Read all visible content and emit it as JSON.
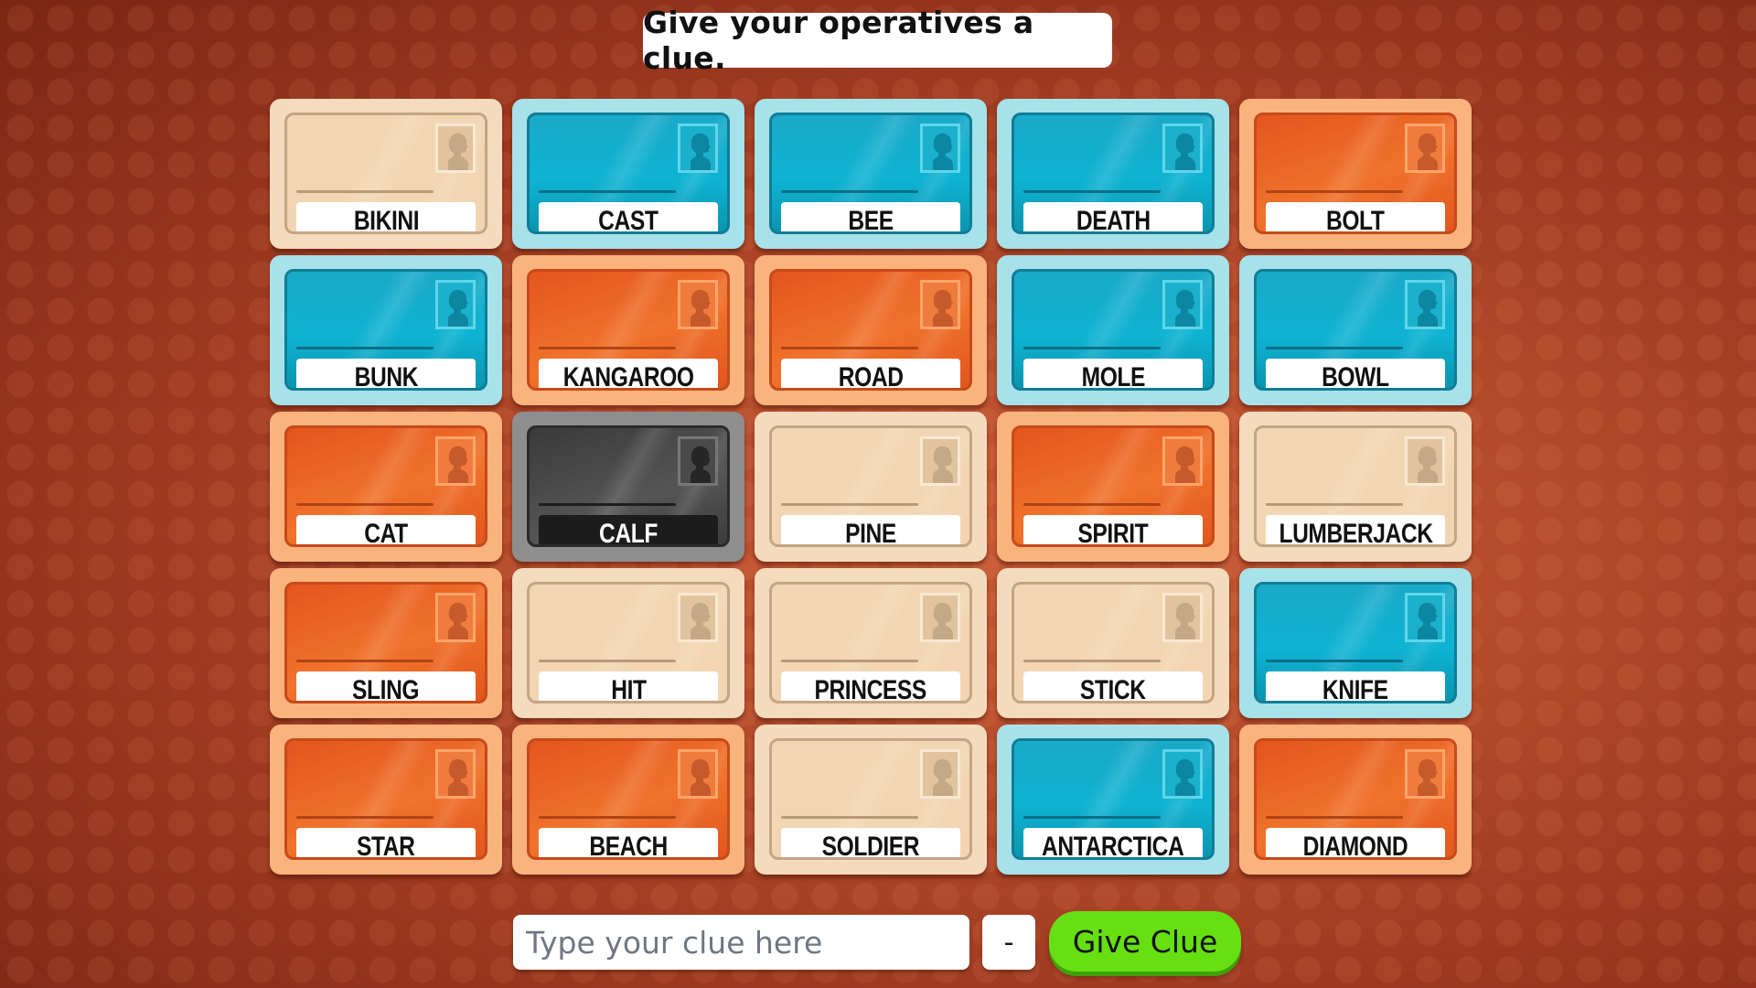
{
  "prompt": "Give your operatives a clue.",
  "colors": {
    "blue": "#0fb3d3",
    "red": "#f0732c",
    "neutral": "#f2d6b3",
    "assassin": "#3a3a3a",
    "give_clue_button": "#66e012"
  },
  "board": {
    "cards": [
      {
        "word": "BIKINI",
        "team": "neutral"
      },
      {
        "word": "CAST",
        "team": "blue"
      },
      {
        "word": "BEE",
        "team": "blue"
      },
      {
        "word": "DEATH",
        "team": "blue"
      },
      {
        "word": "BOLT",
        "team": "red"
      },
      {
        "word": "BUNK",
        "team": "blue"
      },
      {
        "word": "KANGAROO",
        "team": "red"
      },
      {
        "word": "ROAD",
        "team": "red"
      },
      {
        "word": "MOLE",
        "team": "blue"
      },
      {
        "word": "BOWL",
        "team": "blue"
      },
      {
        "word": "CAT",
        "team": "red"
      },
      {
        "word": "CALF",
        "team": "assassin"
      },
      {
        "word": "PINE",
        "team": "neutral"
      },
      {
        "word": "SPIRIT",
        "team": "red"
      },
      {
        "word": "LUMBERJACK",
        "team": "neutral"
      },
      {
        "word": "SLING",
        "team": "red"
      },
      {
        "word": "HIT",
        "team": "neutral"
      },
      {
        "word": "PRINCESS",
        "team": "neutral"
      },
      {
        "word": "STICK",
        "team": "neutral"
      },
      {
        "word": "KNIFE",
        "team": "blue"
      },
      {
        "word": "STAR",
        "team": "red"
      },
      {
        "word": "BEACH",
        "team": "red"
      },
      {
        "word": "SOLDIER",
        "team": "neutral"
      },
      {
        "word": "ANTARCTICA",
        "team": "blue"
      },
      {
        "word": "DIAMOND",
        "team": "red"
      }
    ]
  },
  "clue": {
    "value": "",
    "placeholder": "Type your clue here",
    "count_label": "-",
    "submit_label": "Give Clue"
  },
  "icons": {
    "card_portrait": "agent-silhouette-icon"
  }
}
